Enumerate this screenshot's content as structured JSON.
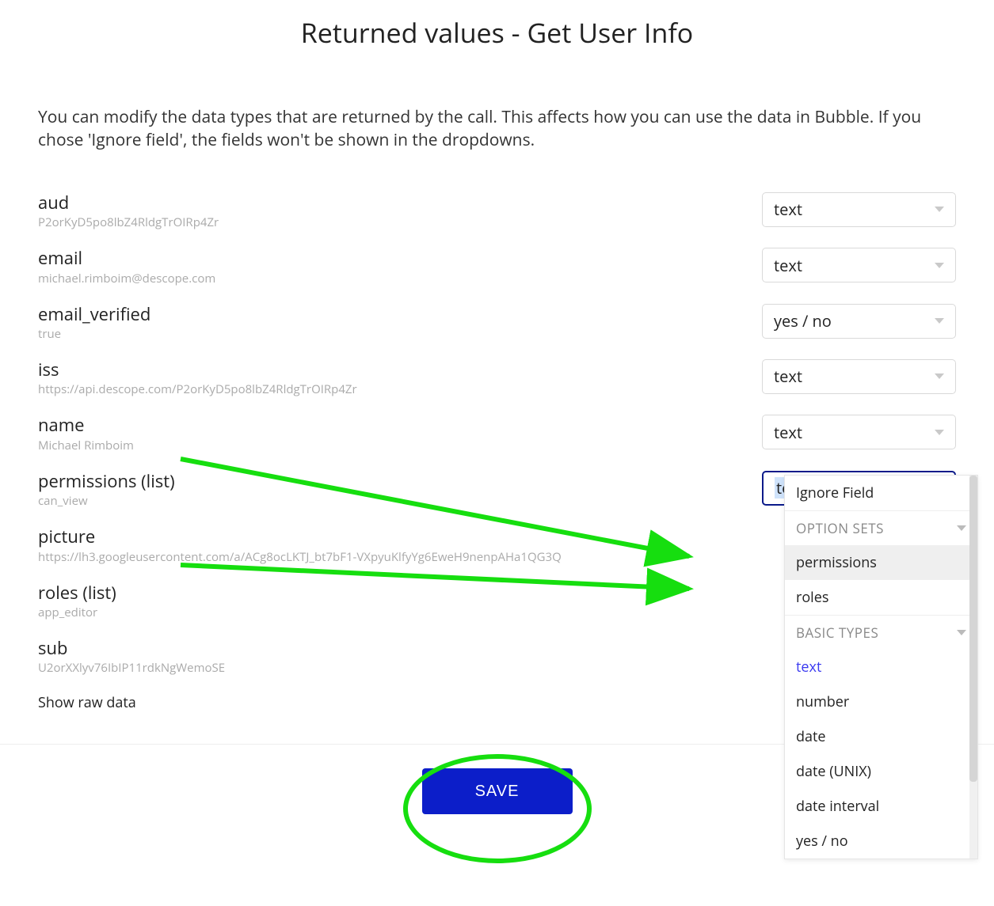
{
  "title": "Returned values - Get User Info",
  "description": "You can modify the data types that are returned by the call. This affects how you can use the data in Bubble. If you chose 'Ignore field', the fields won't be shown in the dropdowns.",
  "fields": [
    {
      "name": "aud",
      "sample": "P2orKyD5po8lbZ4RldgTrOIRp4Zr",
      "type": "text",
      "active": false
    },
    {
      "name": "email",
      "sample": "michael.rimboim@descope.com",
      "type": "text",
      "active": false
    },
    {
      "name": "email_verified",
      "sample": "true",
      "type": "yes / no",
      "active": false
    },
    {
      "name": "iss",
      "sample": "https://api.descope.com/P2orKyD5po8lbZ4RldgTrOIRp4Zr",
      "type": "text",
      "active": false
    },
    {
      "name": "name",
      "sample": "Michael Rimboim",
      "type": "text",
      "active": false
    },
    {
      "name": "permissions (list)",
      "sample": "can_view",
      "type": "text",
      "active": true
    },
    {
      "name": "picture",
      "sample": "https://lh3.googleusercontent.com/a/ACg8ocLKTJ_bt7bF1-VXpyuKlfyYg6EweH9nenpAHa1QG3Q",
      "type": "",
      "active": false,
      "hidden": true
    },
    {
      "name": "roles (list)",
      "sample": "app_editor",
      "type": "",
      "active": false,
      "hidden": true
    },
    {
      "name": "sub",
      "sample": "U2orXXlyv76IbIP11rdkNgWemoSE",
      "type": "",
      "active": false,
      "hidden": true
    }
  ],
  "show_raw_label": "Show raw data",
  "save_label": "SAVE",
  "dropdown": {
    "ignore_label": "Ignore Field",
    "option_sets_header": "OPTION SETS",
    "option_sets": [
      "permissions",
      "roles"
    ],
    "basic_types_header": "BASIC TYPES",
    "basic_types": [
      "text",
      "number",
      "date",
      "date (UNIX)",
      "date interval",
      "yes / no"
    ],
    "selected": "text",
    "hovered": "permissions"
  }
}
